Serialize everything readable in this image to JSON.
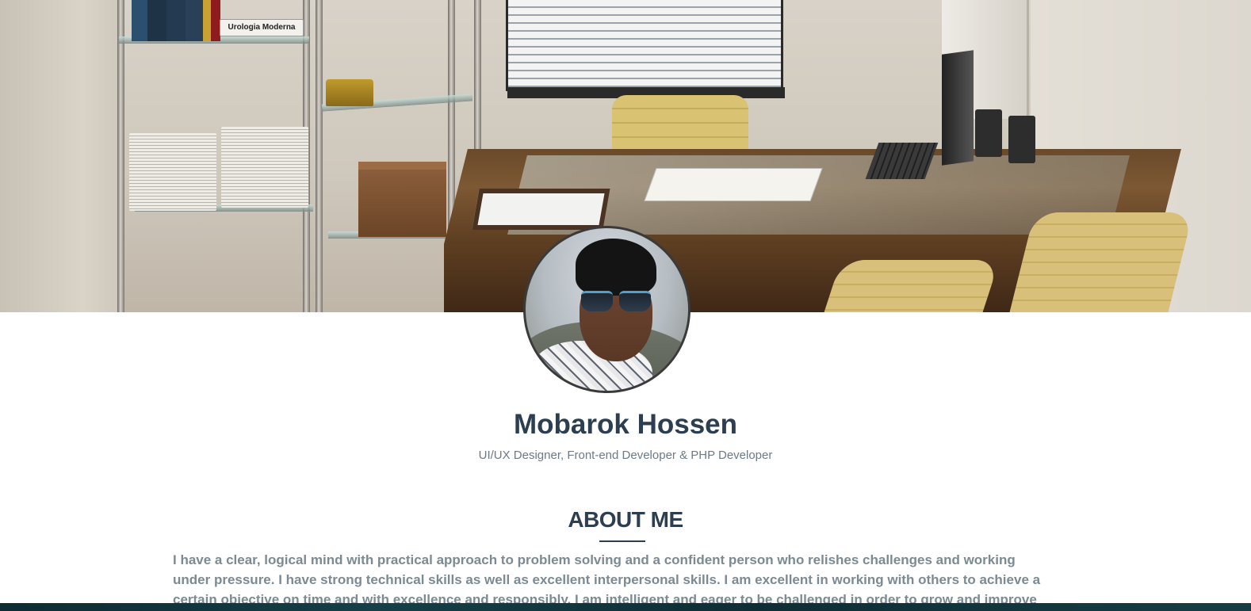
{
  "hero": {
    "shelf_sign": "Urologia Moderna"
  },
  "profile": {
    "name": "Mobarok Hossen",
    "tagline": "UI/UX Designer, Front-end Developer & PHP Developer"
  },
  "about": {
    "heading": "ABOUT ME",
    "text": "I have a clear, logical mind with practical approach to problem solving and a confident person who relishes challenges and working under pressure. I have strong technical skills as well as excellent interpersonal skills. I am excellent in working with others to achieve a certain objective on time and with excellence and responsibly. I am intelligent and eager to be challenged in order to grow and improve my"
  },
  "colors": {
    "heading": "#2c3e50",
    "muted_text": "#7b8a93",
    "tagline": "#6c7a86"
  }
}
